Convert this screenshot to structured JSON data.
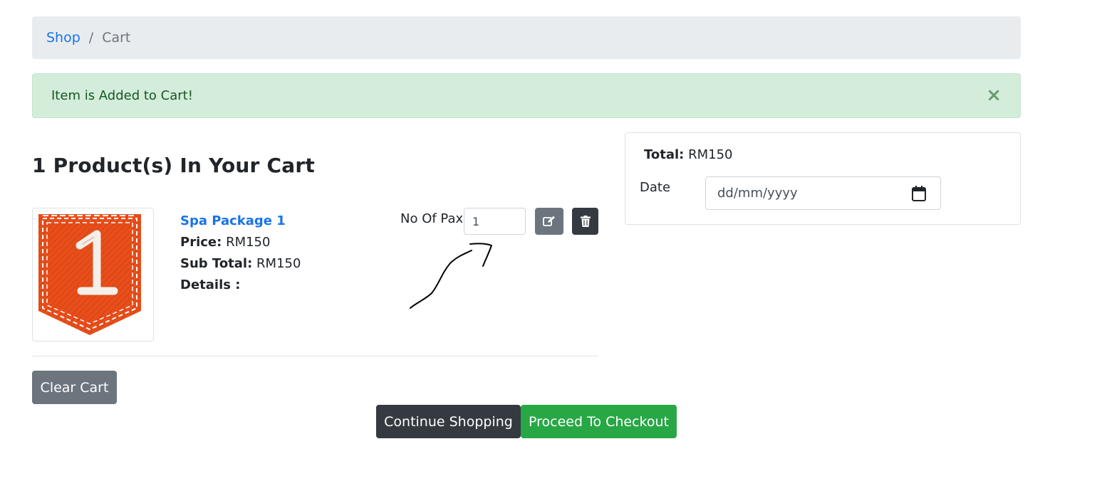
{
  "breadcrumb": {
    "shop": "Shop",
    "separator": "/",
    "current": "Cart"
  },
  "alert": {
    "message": "Item is Added to Cart!",
    "close": "×"
  },
  "cart": {
    "heading": "1 Product(s) In Your Cart",
    "item": {
      "name": "Spa Package 1",
      "price_label": "Price:",
      "price": "RM150",
      "subtotal_label": "Sub Total:",
      "subtotal": "RM150",
      "details_label": "Details :",
      "pax_label": "No Of Pax",
      "pax_value": "1"
    },
    "clear_label": "Clear Cart"
  },
  "summary": {
    "total_label": "Total:",
    "total_value": "RM150",
    "date_label": "Date",
    "date_placeholder": "dd/mm/yyyy"
  },
  "actions": {
    "continue_label": "Continue Shopping",
    "checkout_label": "Proceed To Checkout"
  },
  "colors": {
    "link": "#1a73e8",
    "success_bg": "#d4edda",
    "primary_dark": "#343a40",
    "secondary": "#6c757d",
    "success": "#28a745",
    "thumb_orange": "#e84e1b"
  },
  "icons": {
    "edit": "edit-icon",
    "delete": "trash-icon",
    "calendar": "calendar-icon",
    "close": "close-icon"
  }
}
